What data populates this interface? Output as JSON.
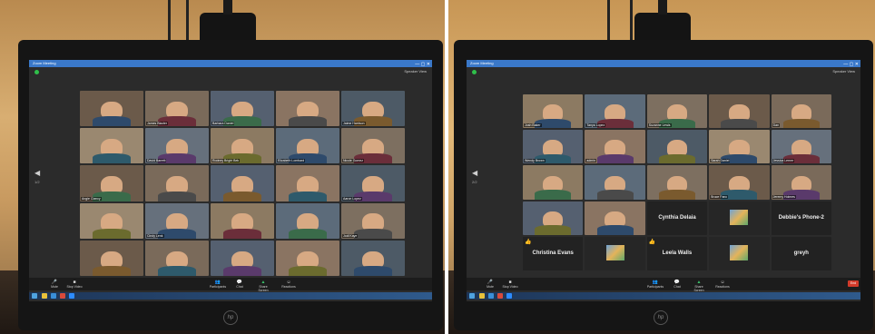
{
  "left_photo": {
    "window_title": "Zoom Meeting",
    "view_label": "Speaker View",
    "page_indicator": "1/2",
    "participants": [
      "",
      "James Blazier",
      "Barbara Daniel",
      "",
      "Jaime Harrison",
      "",
      "David Barrett",
      "Rodney Bright Bek",
      "Elizabeth Lombard",
      "Nicole Gomez",
      "Angie Clancy",
      "",
      "",
      "",
      "Aaron Lopez",
      "",
      "Cindy Lenk",
      "",
      "",
      "Jodi Kaye",
      "",
      "",
      "",
      "",
      ""
    ],
    "toolbar": [
      "Mute",
      "Stop Video",
      "Participants",
      "Chat",
      "Share Screen",
      "Reactions"
    ]
  },
  "right_photo": {
    "window_title": "Zoom Meeting",
    "view_label": "Speaker View",
    "page_indicator": "2/2",
    "participants": [
      "Josh Baker",
      "Tanya Lopez",
      "Suzanne Lewis",
      "",
      "Dan",
      "Wendy Brown",
      "admin",
      "",
      "Sarah Daniel",
      "Jessica Lerner",
      "",
      "",
      "",
      "Bruce Fanc",
      "Jeremy Holmes",
      "",
      "",
      "Cynthia Delaia",
      "",
      "Debbie's Phone-2",
      "Christina Evans",
      "",
      "Leela Walls",
      "",
      "greyh"
    ],
    "toolbar": [
      "Mute",
      "Stop Video",
      "Participants",
      "Chat",
      "Share Screen",
      "Reactions"
    ],
    "end_label": "End"
  },
  "brand": "hp"
}
